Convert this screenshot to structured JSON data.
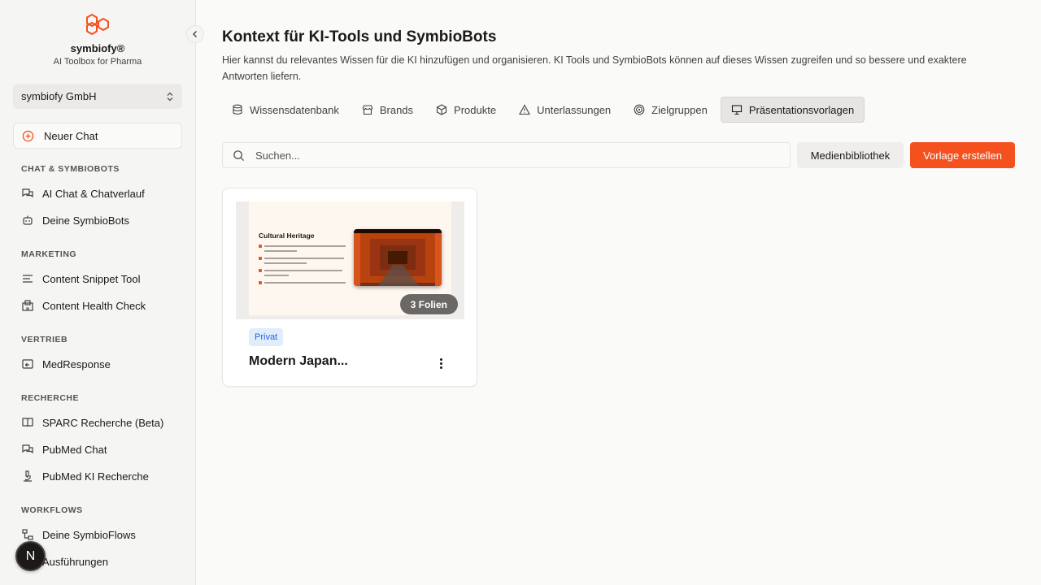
{
  "app": {
    "brand_name": "symbiofy®",
    "brand_subtitle": "AI Toolbox for Pharma",
    "brand_color": "#f4511e",
    "org_name": "symbiofy GmbH",
    "new_chat_label": "Neuer Chat"
  },
  "sidebar": {
    "sections": [
      {
        "title": "CHAT & SYMBIOBOTS",
        "items": [
          {
            "label": "AI Chat & Chatverlauf",
            "icon": "chat-bubbles-icon"
          },
          {
            "label": "Deine SymbioBots",
            "icon": "bot-icon"
          }
        ]
      },
      {
        "title": "MARKETING",
        "items": [
          {
            "label": "Content Snippet Tool",
            "icon": "text-lines-icon"
          },
          {
            "label": "Content Health Check",
            "icon": "hospital-icon"
          }
        ]
      },
      {
        "title": "VERTRIEB",
        "items": [
          {
            "label": "MedResponse",
            "icon": "reply-icon"
          }
        ]
      },
      {
        "title": "RECHERCHE",
        "items": [
          {
            "label": "SPARC Recherche (Beta)",
            "icon": "book-icon"
          },
          {
            "label": "PubMed Chat",
            "icon": "chat-bubbles-icon"
          },
          {
            "label": "PubMed KI Recherche",
            "icon": "microscope-icon"
          }
        ]
      },
      {
        "title": "WORKFLOWS",
        "items": [
          {
            "label": "Deine SymbioFlows",
            "icon": "workflow-icon"
          },
          {
            "label": "Ausführungen",
            "icon": "run-icon"
          }
        ]
      }
    ],
    "avatar_letter": "N"
  },
  "main": {
    "title": "Kontext für KI-Tools und SymbioBots",
    "description": "Hier kannst du relevantes Wissen für die KI hinzufügen und organisieren. KI Tools und SymbioBots können auf dieses Wissen zugreifen und so bessere und exaktere Antworten liefern.",
    "tabs": [
      {
        "label": "Wissensdatenbank",
        "icon": "database-icon",
        "active": false
      },
      {
        "label": "Brands",
        "icon": "store-icon",
        "active": false
      },
      {
        "label": "Produkte",
        "icon": "package-icon",
        "active": false
      },
      {
        "label": "Unterlassungen",
        "icon": "warning-icon",
        "active": false
      },
      {
        "label": "Zielgruppen",
        "icon": "target-icon",
        "active": false
      },
      {
        "label": "Präsentationsvorlagen",
        "icon": "presentation-icon",
        "active": true
      }
    ],
    "search_placeholder": "Suchen...",
    "media_library_label": "Medienbibliothek",
    "create_template_label": "Vorlage erstellen",
    "cards": [
      {
        "slide_title": "Cultural Heritage",
        "slides_badge": "3 Folien",
        "visibility": "Privat",
        "title": "Modern Japan..."
      }
    ]
  }
}
